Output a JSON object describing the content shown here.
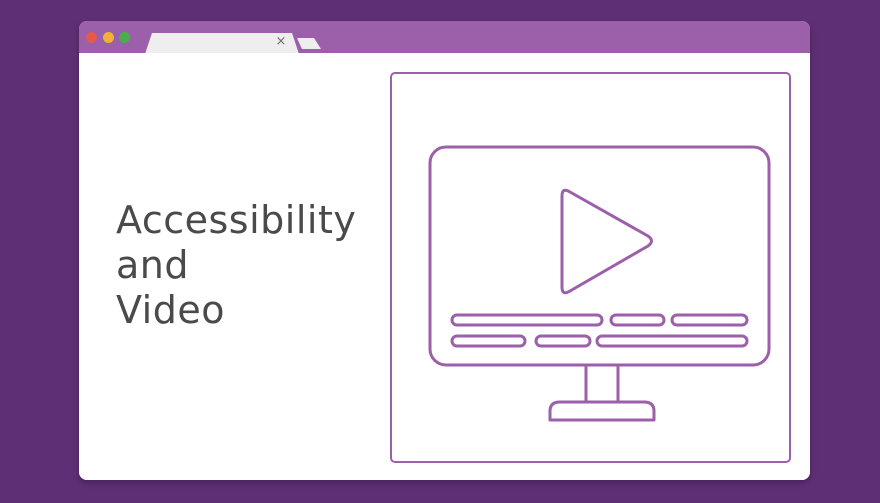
{
  "colors": {
    "background": "#5e2f74",
    "titlebar": "#9c5fa9",
    "accent": "#9c5fa9",
    "tab": "#eeeeef",
    "text": "#4a4a4a",
    "window_controls": [
      "#e5594f",
      "#f2b134",
      "#48b04b"
    ]
  },
  "browser": {
    "tabs": [
      {
        "title": "",
        "close_icon": "close-icon",
        "close_glyph": "×"
      }
    ],
    "new_tab_icon": "new-tab-icon"
  },
  "page": {
    "heading_lines": [
      "Accessibility",
      "and",
      "Video"
    ]
  },
  "illustration": {
    "icon": "monitor-play-icon",
    "caption_rows": 2
  }
}
